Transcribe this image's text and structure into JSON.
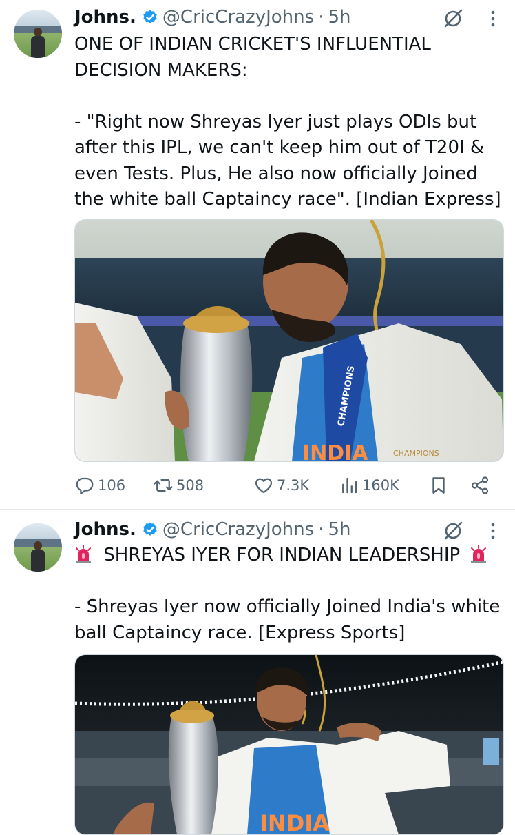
{
  "tweets": [
    {
      "author_name": "Johns.",
      "handle": "@CricCrazyJohns",
      "separator": "·",
      "time": "5h",
      "text_lines": [
        "ONE OF INDIAN CRICKET'S INFLUENTIAL",
        "DECISION MAKERS:",
        "",
        "- \"Right now Shreyas Iyer just plays ODIs but",
        "after this IPL, we can't keep him out of T20I &",
        "even Tests. Plus, He also now officially Joined",
        "the white ball Captaincy race\". [Indian Express]"
      ],
      "media_text": {
        "sash": "CHAMPIONS",
        "jersey": "INDIA",
        "blazer": "CHAMPIONS"
      },
      "metrics": {
        "replies": "106",
        "reposts": "508",
        "likes": "7.3K",
        "views": "160K"
      }
    },
    {
      "author_name": "Johns.",
      "handle": "@CricCrazyJohns",
      "separator": "·",
      "time": "5h",
      "headline": "SHREYAS IYER FOR INDIAN LEADERSHIP",
      "text_lines": [
        "- Shreyas Iyer now officially Joined India's white",
        "ball Captaincy race. [Express Sports]"
      ],
      "media_text": {
        "jersey": "INDIA"
      }
    }
  ],
  "colors": {
    "text": "#0f1419",
    "secondary": "#536471",
    "verified": "#1d9bf0",
    "divider": "#e6e9ec",
    "siren": "#e0245e"
  },
  "icons": [
    "verified-badge-icon",
    "grok-icon",
    "more-icon",
    "reply-icon",
    "repost-icon",
    "like-icon",
    "views-icon",
    "bookmark-icon",
    "share-icon",
    "siren-icon"
  ]
}
